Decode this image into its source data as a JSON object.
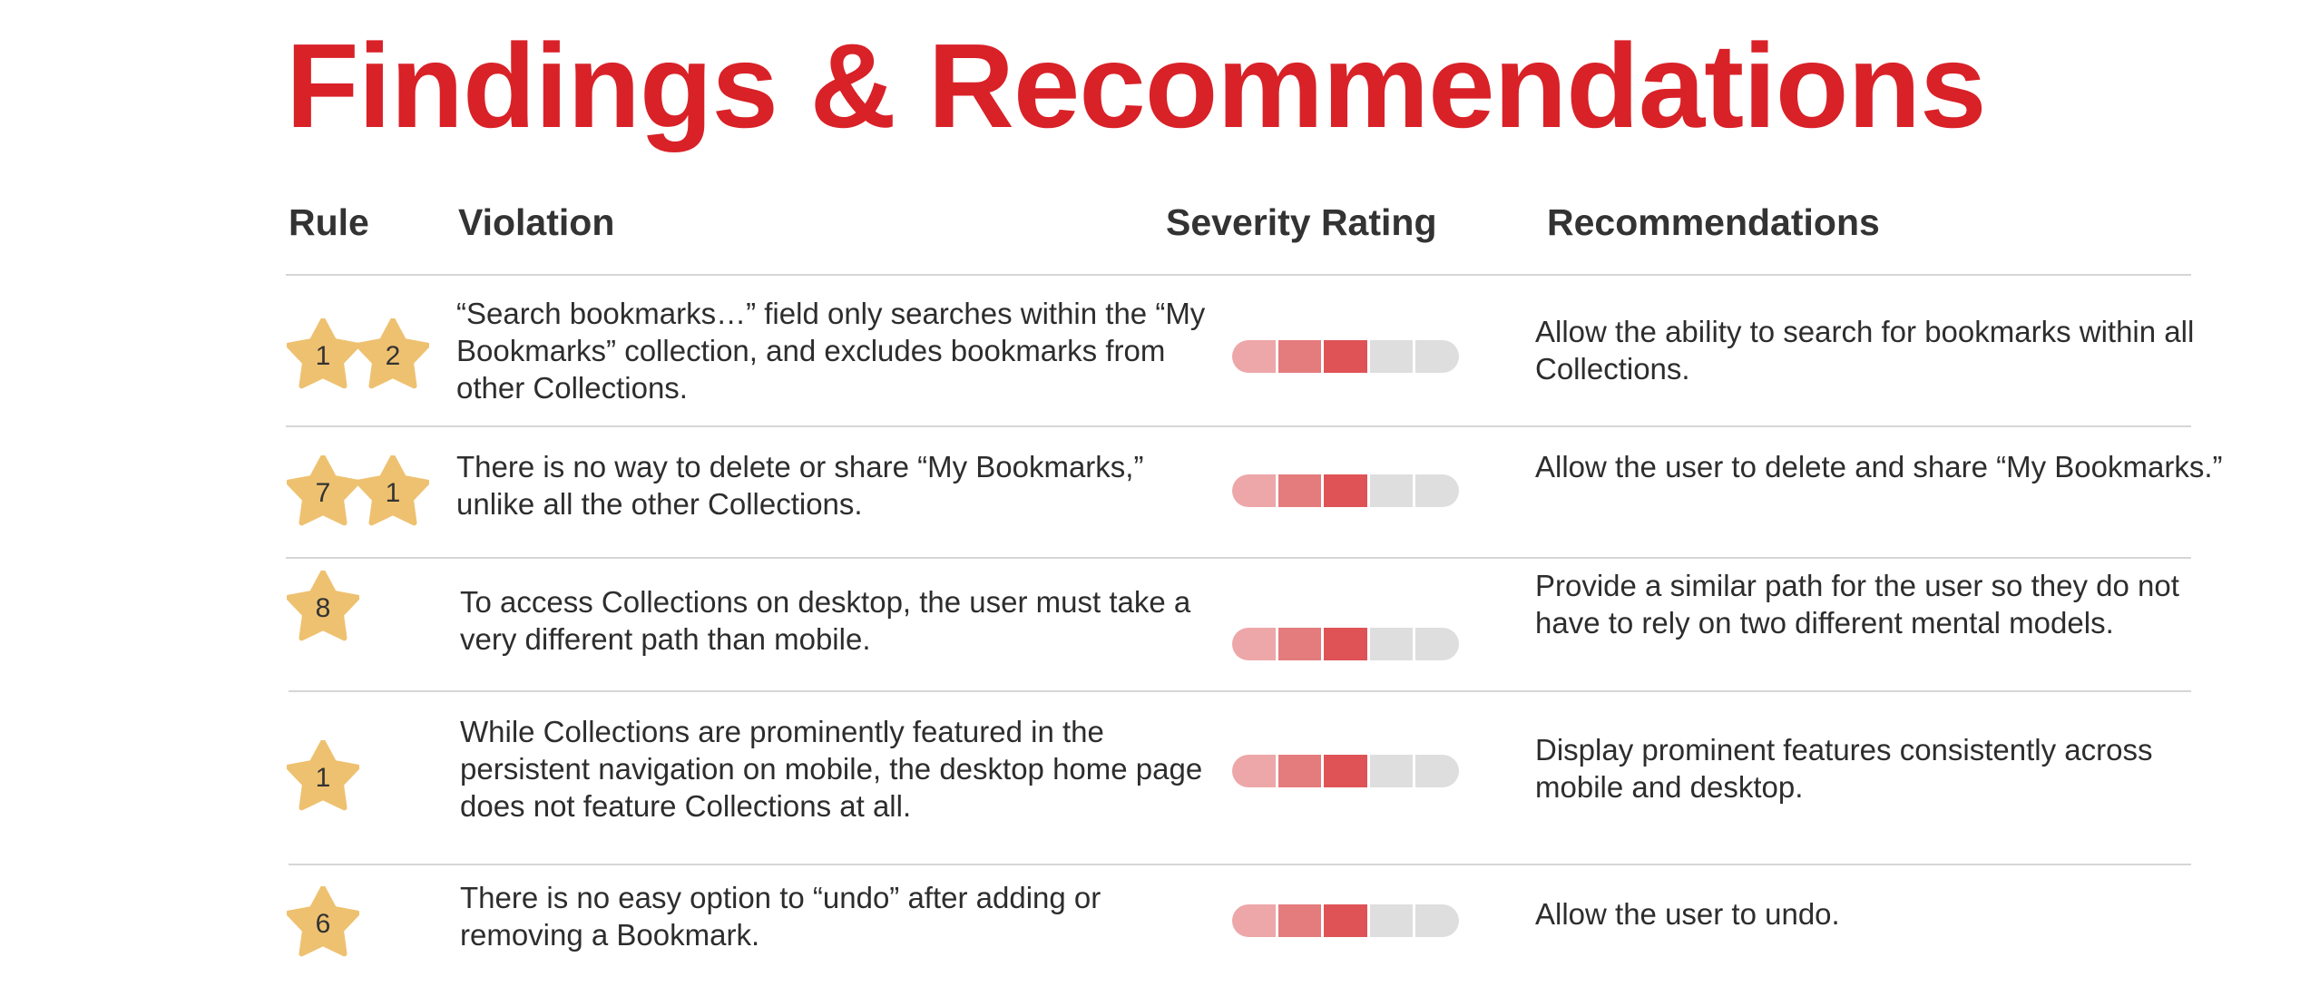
{
  "title": "Findings & Recommendations",
  "headers": {
    "rule": "Rule",
    "violation": "Violation",
    "severity": "Severity Rating",
    "recommendations": "Recommendations"
  },
  "colors": {
    "title": "#d92128",
    "star": "#eec170",
    "severity_filled": [
      "#eda7a9",
      "#e47c7e",
      "#df5357"
    ],
    "severity_empty": "#dedede"
  },
  "severity_scale_max": 5,
  "rows": [
    {
      "rules": [
        "1",
        "2"
      ],
      "violation": "“Search bookmarks…” field only searches within the “My Bookmarks” collection, and excludes bookmarks from other Collections.",
      "severity": 3,
      "recommendation": "Allow the ability to search for bookmarks within all Collections."
    },
    {
      "rules": [
        "7",
        "1"
      ],
      "violation": "There is no way to delete or share “My Bookmarks,” unlike all the other Collections.",
      "severity": 3,
      "recommendation": "Allow the user to delete and share “My Bookmarks.”"
    },
    {
      "rules": [
        "8"
      ],
      "violation": "To access Collections on desktop, the user must take a very different path than mobile.",
      "severity": 3,
      "recommendation": "Provide a similar path for the user so they do not have to rely on two different mental models."
    },
    {
      "rules": [
        "1"
      ],
      "violation": "While Collections are prominently featured in the persistent navigation on mobile, the desktop home page does not feature Collections at all.",
      "severity": 3,
      "recommendation": "Display prominent features consistently across mobile and desktop."
    },
    {
      "rules": [
        "6"
      ],
      "violation": "There is no easy option to “undo” after adding or removing a Bookmark.",
      "severity": 3,
      "recommendation": "Allow the user to undo."
    }
  ]
}
